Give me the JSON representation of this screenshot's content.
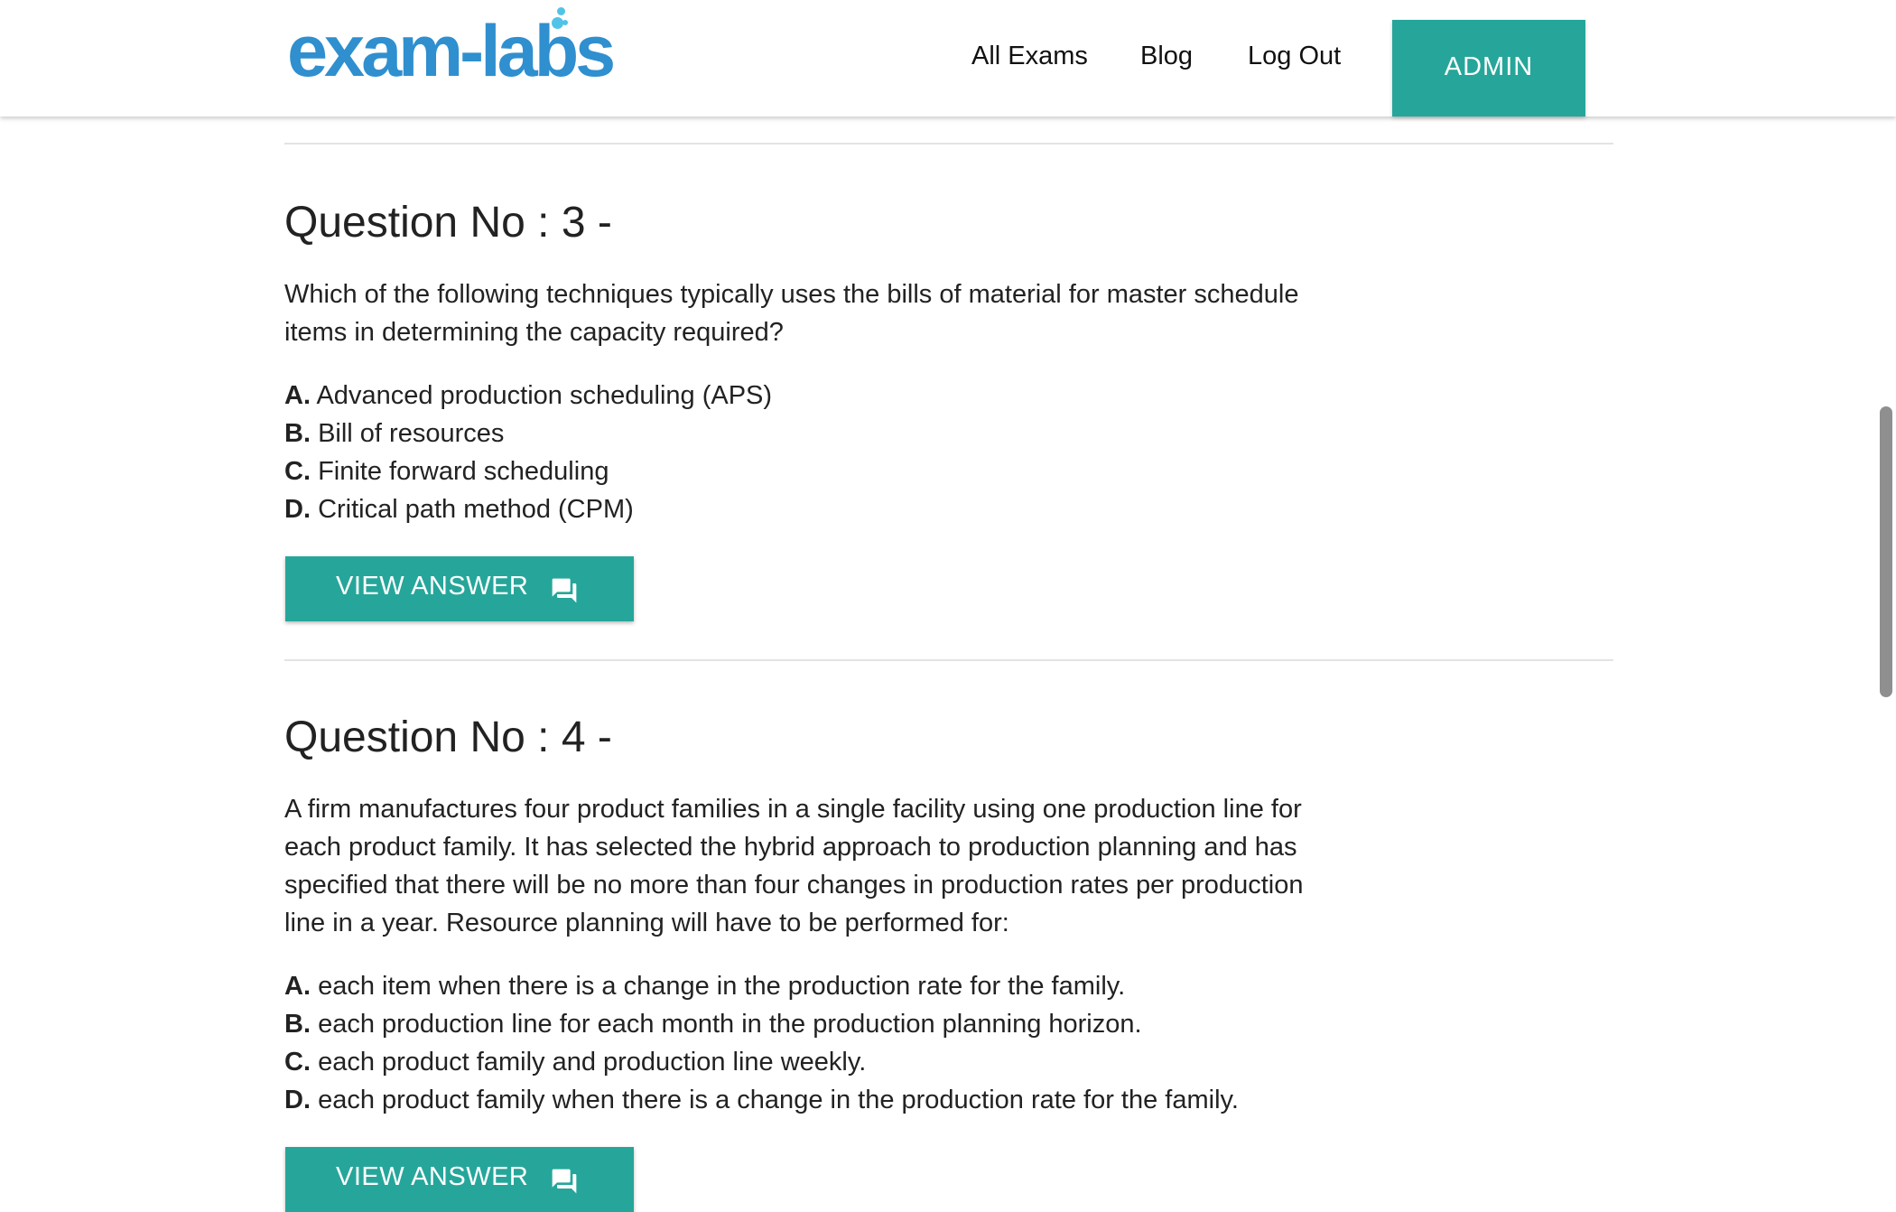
{
  "header": {
    "logo_text": "exam-labs",
    "nav": [
      "All Exams",
      "Blog",
      "Log Out"
    ],
    "admin_label": "ADMIN"
  },
  "questions": [
    {
      "title": "Question No : 3 -",
      "text": "Which of the following techniques typically uses the bills of material for master schedule items in determining the capacity required?",
      "options": [
        {
          "letter": "A.",
          "text": "Advanced production scheduling (APS)"
        },
        {
          "letter": "B.",
          "text": "Bill of resources"
        },
        {
          "letter": "C.",
          "text": "Finite forward scheduling"
        },
        {
          "letter": "D.",
          "text": "Critical path method (CPM)"
        }
      ],
      "button_label": "VIEW ANSWER"
    },
    {
      "title": "Question No : 4 -",
      "text": "A firm manufactures four product families in a single facility using one production line for each product family. It has selected the hybrid approach to production planning and has specified that there will be no more than four changes in production rates per production line in a year. Resource planning will have to be performed for:",
      "options": [
        {
          "letter": "A.",
          "text": "each item when there is a change in the production rate for the family."
        },
        {
          "letter": "B.",
          "text": "each production line for each month in the production planning horizon."
        },
        {
          "letter": "C.",
          "text": "each product family and production line weekly."
        },
        {
          "letter": "D.",
          "text": "each product family when there is a change in the production rate for the family."
        }
      ],
      "button_label": "VIEW ANSWER"
    }
  ],
  "colors": {
    "accent": "#26a69a",
    "logo": "#2f8fcf",
    "divider": "#e3e3e3"
  },
  "icons": {
    "view_answer": "forum-icon",
    "logo_bubbles": "bubble-dots-icon"
  }
}
